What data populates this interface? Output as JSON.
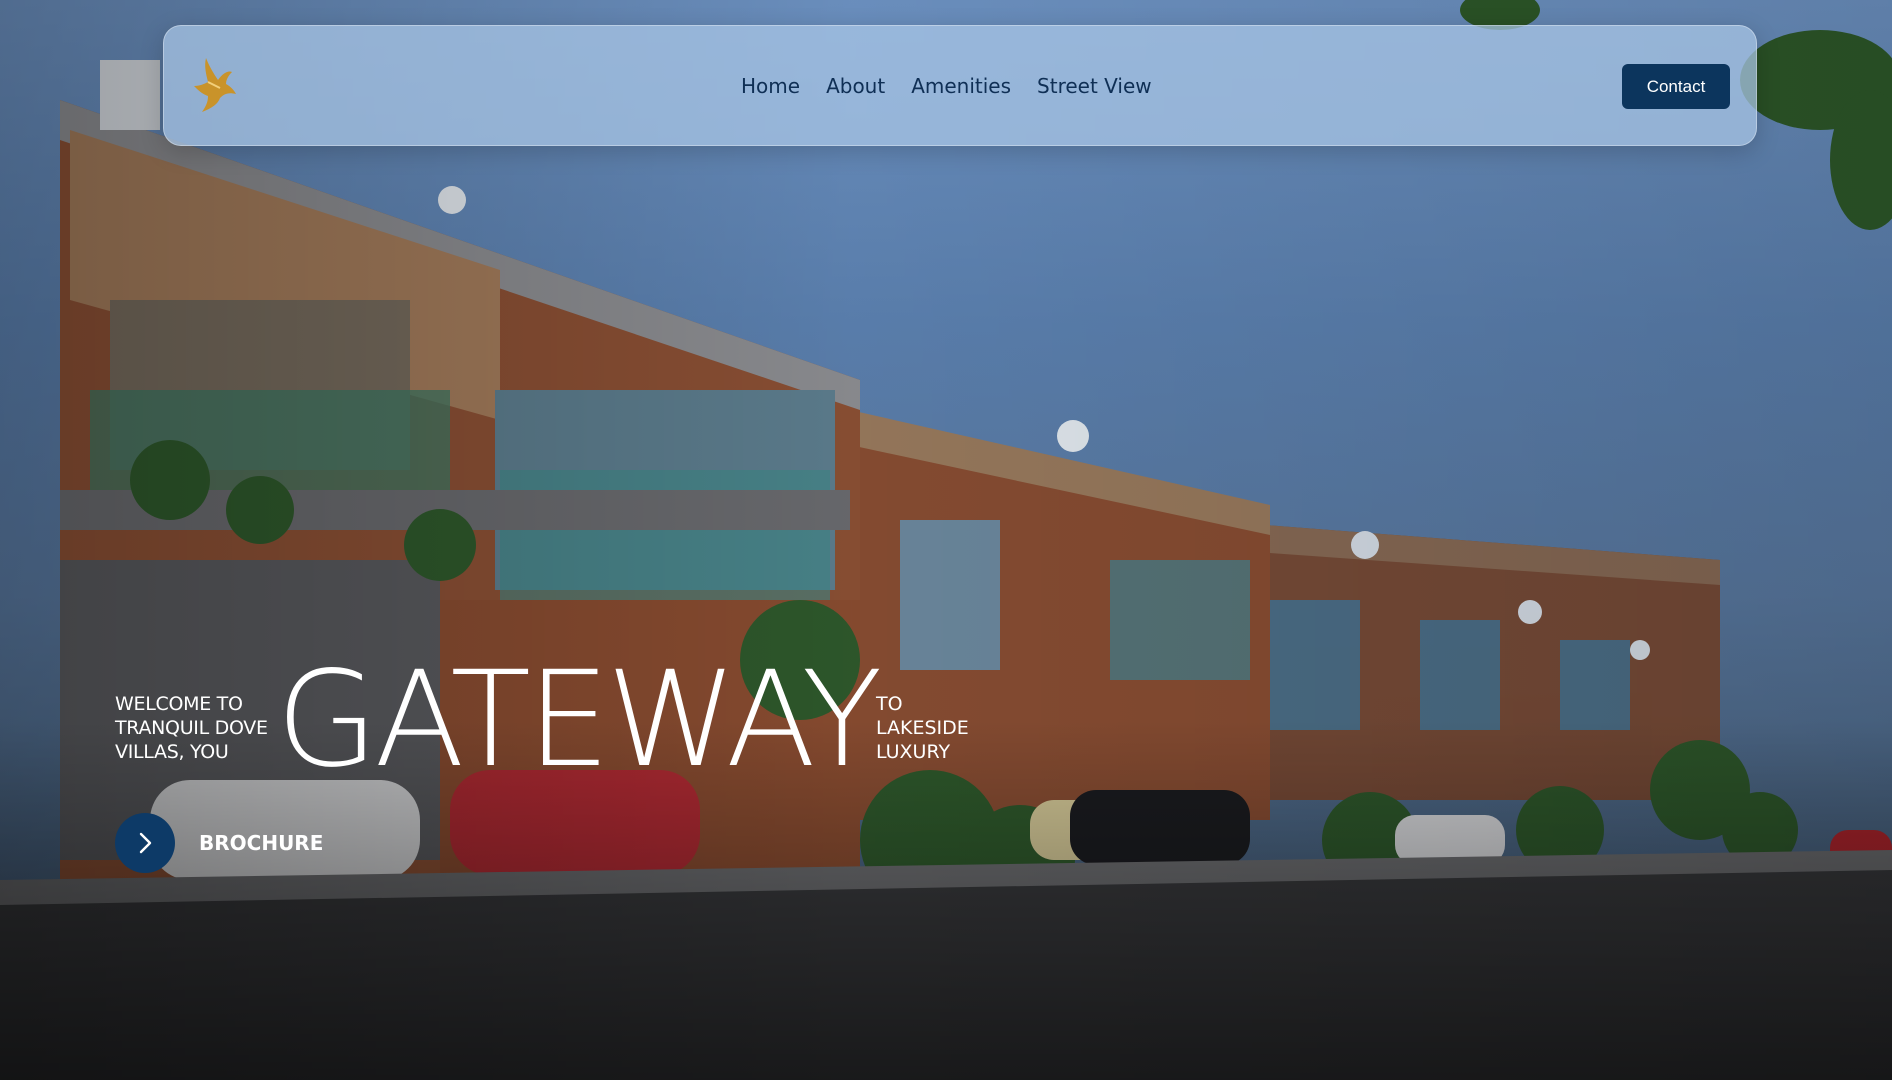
{
  "brand": {
    "logo_icon": "dove-logo-icon",
    "logo_color": "#c9932a"
  },
  "nav": {
    "links": [
      "Home",
      "About",
      "Amenities",
      "Street View"
    ],
    "contact_label": "Contact"
  },
  "hero": {
    "welcome_text": "WELCOME TO TRANQUIL DOVE VILLAS, YOU",
    "headline": "GATEWAY",
    "tagline_text": "TO LAKESIDE LUXURY",
    "brochure_label": "BROCHURE",
    "brochure_icon": "chevron-right-icon"
  },
  "colors": {
    "accent": "#0c355d",
    "nav_text": "#0f2f55"
  }
}
